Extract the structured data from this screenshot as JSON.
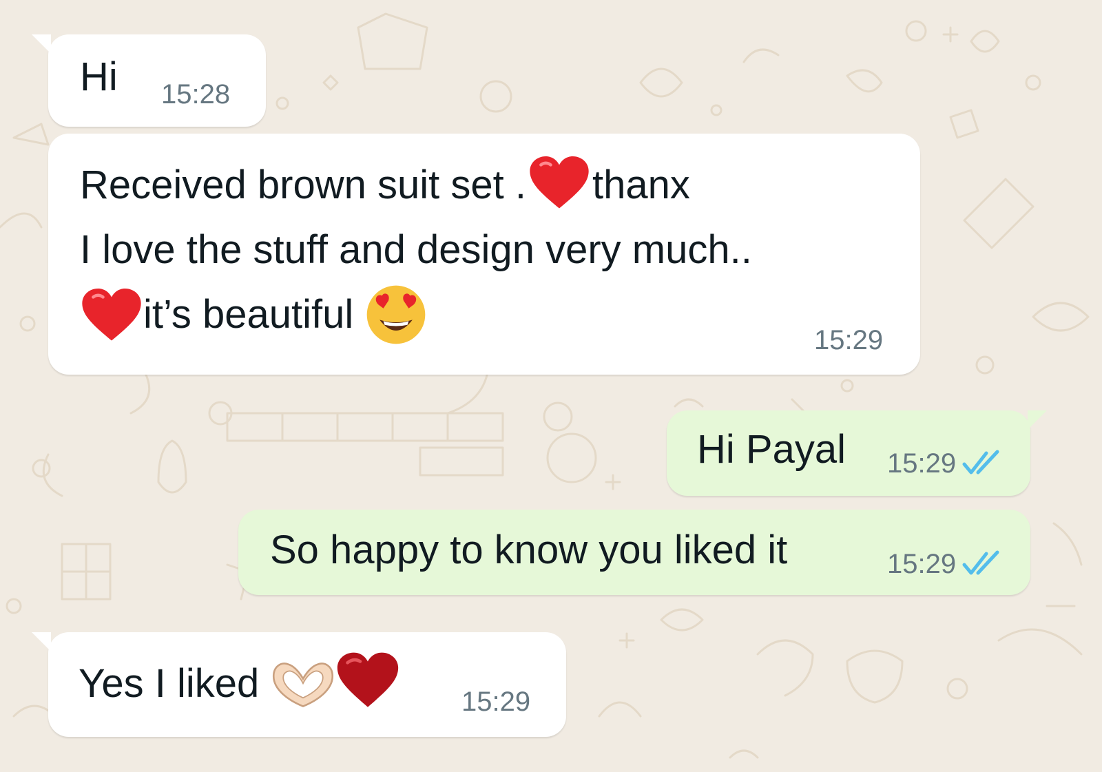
{
  "colors": {
    "wallpaper": "#f1ebe2",
    "incoming_bubble": "#ffffff",
    "outgoing_bubble": "#e6f8d8",
    "text": "#111b21",
    "timestamp": "#667781",
    "read_ticks": "#53bdeb"
  },
  "messages": [
    {
      "direction": "incoming",
      "lines": [
        "Hi"
      ],
      "time": "15:28"
    },
    {
      "direction": "incoming",
      "lines": [
        {
          "parts": [
            "Received brown suit set .",
            "red-heart-emoji",
            "thanx"
          ]
        },
        {
          "parts": [
            "I love the stuff and design very much.."
          ]
        },
        {
          "parts": [
            "red-heart-emoji",
            "it’s beautiful ",
            "heart-eyes-emoji"
          ]
        }
      ],
      "time": "15:29"
    },
    {
      "direction": "outgoing",
      "lines": [
        "Hi Payal"
      ],
      "time": "15:29",
      "status": "read"
    },
    {
      "direction": "outgoing",
      "lines": [
        "So happy to know you liked it"
      ],
      "time": "15:29",
      "status": "read"
    },
    {
      "direction": "incoming",
      "lines": [
        {
          "parts": [
            "Yes I liked ",
            "heart-hands-emoji",
            "dark-red-heart-emoji"
          ]
        }
      ],
      "time": "15:29"
    }
  ],
  "text": {
    "m1": "Hi",
    "m2_l1": "Received brown suit set .",
    "m2_l1b": "thanx",
    "m2_l2": "I love the stuff and design very much..",
    "m2_l3": "it’s beautiful ",
    "m3": "Hi Payal",
    "m4": "So happy to know you liked it",
    "m5": "Yes I liked "
  },
  "times": {
    "m1": "15:28",
    "m2": "15:29",
    "m3": "15:29",
    "m4": "15:29",
    "m5": "15:29"
  }
}
